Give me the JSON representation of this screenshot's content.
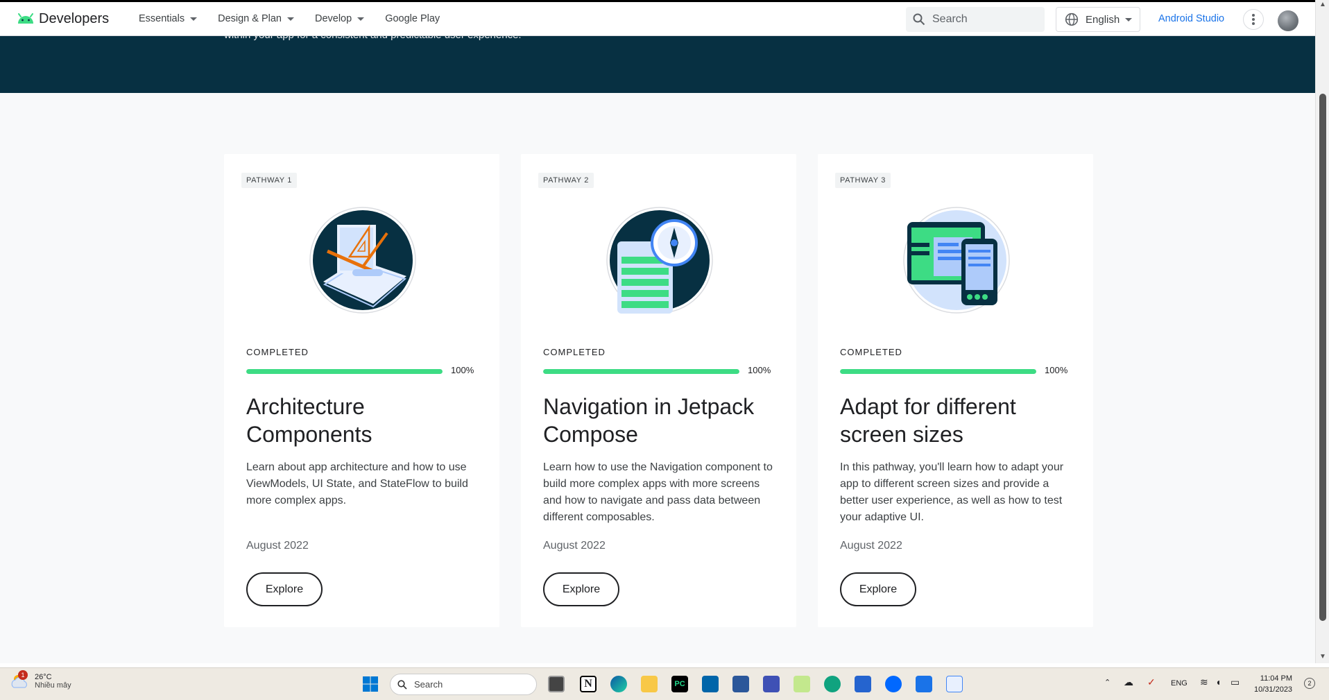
{
  "header": {
    "logo_text": "Developers",
    "nav": [
      {
        "label": "Essentials",
        "dropdown": true
      },
      {
        "label": "Design & Plan",
        "dropdown": true
      },
      {
        "label": "Develop",
        "dropdown": true
      },
      {
        "label": "Google Play",
        "dropdown": false
      }
    ],
    "search_placeholder": "Search",
    "language": "English",
    "studio_link": "Android Studio"
  },
  "banner": {
    "text": "within your app for a consistent and predictable user experience."
  },
  "cards": [
    {
      "badge": "PATHWAY 1",
      "status": "COMPLETED",
      "progress_percent": 100,
      "progress_label": "100%",
      "title": "Architecture Components",
      "description": "Learn about app architecture and how to use ViewModels, UI State, and StateFlow to build more complex apps.",
      "date": "August 2022",
      "button": "Explore",
      "icon": "drafting-tools-icon"
    },
    {
      "badge": "PATHWAY 2",
      "status": "COMPLETED",
      "progress_percent": 100,
      "progress_label": "100%",
      "title": "Navigation in Jetpack Compose",
      "description": "Learn how to use the Navigation component to build more complex apps with more screens and how to navigate and pass data between different composables.",
      "date": "August 2022",
      "button": "Explore",
      "icon": "compass-icon"
    },
    {
      "badge": "PATHWAY 3",
      "status": "COMPLETED",
      "progress_percent": 100,
      "progress_label": "100%",
      "title": "Adapt for different screen sizes",
      "description": "In this pathway, you'll learn how to adapt your app to different screen sizes and provide a better user experience, as well as how to test your adaptive UI.",
      "date": "August 2022",
      "button": "Explore",
      "icon": "devices-icon"
    }
  ],
  "taskbar": {
    "weather_temp": "26°C",
    "weather_condition": "Nhiều mây",
    "weather_badge": "1",
    "search_placeholder": "Search",
    "lang": "ENG",
    "time": "11:04 PM",
    "date": "10/31/2023",
    "notifications": "2"
  },
  "colors": {
    "banner": "#073042",
    "accent_green": "#3ddc84",
    "link_blue": "#1a73e8"
  }
}
